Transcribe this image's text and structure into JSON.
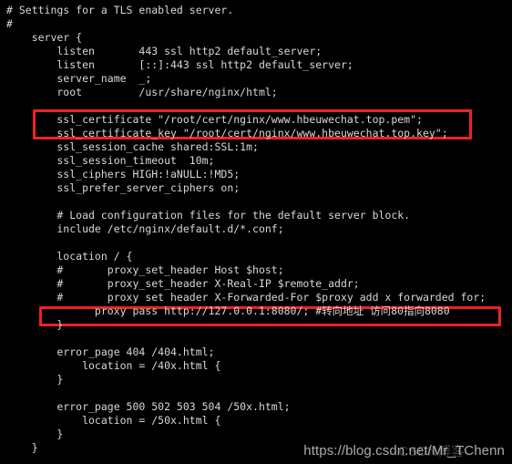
{
  "terminal": {
    "background_color": "#000000",
    "text_color": "#d8d8d8",
    "highlight_color": "#ee2222",
    "lines": [
      "# Settings for a TLS enabled server.",
      "#",
      "    server {",
      "        listen       443 ssl http2 default_server;",
      "        listen       [::]:443 ssl http2 default_server;",
      "        server_name  _;",
      "        root         /usr/share/nginx/html;",
      "",
      "        ssl_certificate \"/root/cert/nginx/www.hbeuwechat.top.pem\";",
      "        ssl_certificate_key \"/root/cert/nginx/www.hbeuwechat.top.key\";",
      "        ssl_session_cache shared:SSL:1m;",
      "        ssl_session_timeout  10m;",
      "        ssl_ciphers HIGH:!aNULL:!MD5;",
      "        ssl_prefer_server_ciphers on;",
      "",
      "        # Load configuration files for the default server block.",
      "        include /etc/nginx/default.d/*.conf;",
      "",
      "        location / {",
      "        #       proxy_set_header Host $host;",
      "        #       proxy_set_header X-Real-IP $remote_addr;",
      "        #       proxy set header X-Forwarded-For $proxy add x forwarded for;",
      "              proxy pass http://127.0.0.1:8080/; #转向地址 访问80指向8080",
      "        }",
      "",
      "        error_page 404 /404.html;",
      "            location = /40x.html {",
      "        }",
      "",
      "        error_page 500 502 503 504 /50x.html;",
      "            location = /50x.html {",
      "        }",
      "    }"
    ]
  },
  "highlights": [
    {
      "name": "ssl-certificate-highlight",
      "color": "#ee2222",
      "covers": "ssl_certificate and ssl_certificate_key directives"
    },
    {
      "name": "proxy-pass-highlight",
      "color": "#ee2222",
      "covers": "proxy pass http://127.0.0.1:8080/ directive"
    }
  ],
  "watermark": {
    "url_text": "https://blog.csdn.net/Mr_TChenn",
    "logo_text": "CSDN博客"
  }
}
